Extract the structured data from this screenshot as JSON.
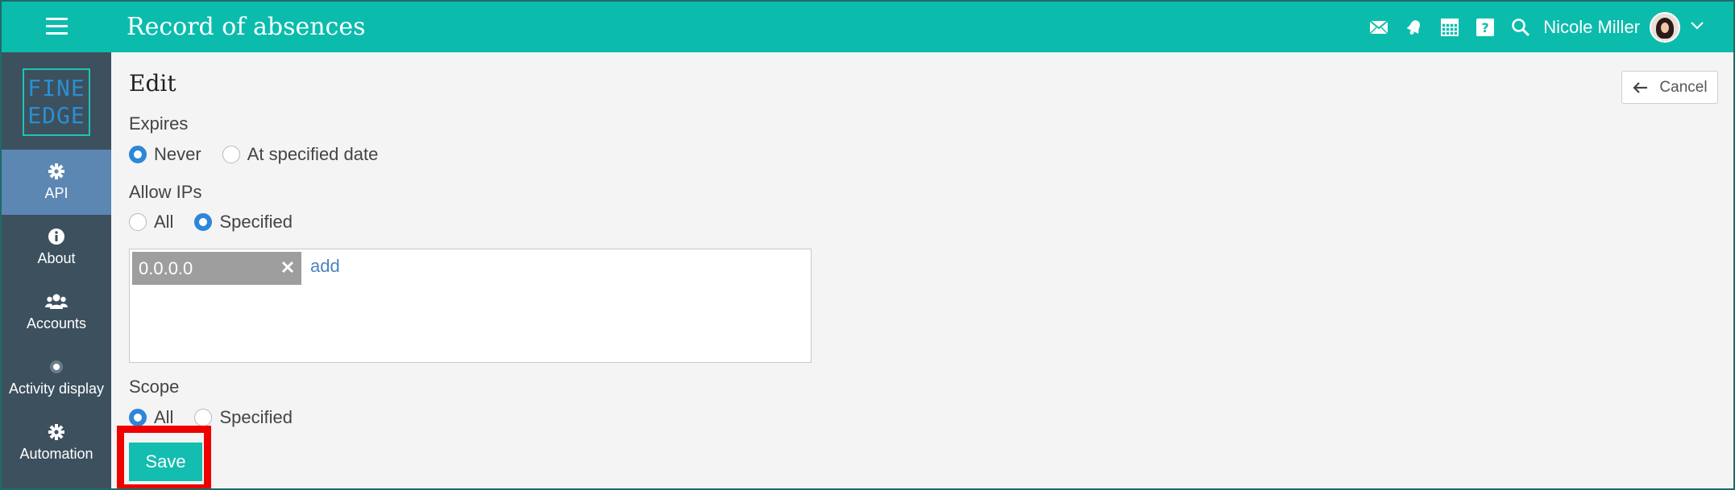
{
  "app": {
    "title": "Record of absences"
  },
  "user": {
    "name": "Nicole Miller"
  },
  "logo": {
    "line1": "FINE",
    "line2": "EDGE"
  },
  "sidebar": {
    "items": [
      {
        "label": "API",
        "icon": "gear-icon",
        "active": true
      },
      {
        "label": "About",
        "icon": "info-icon",
        "active": false
      },
      {
        "label": "Accounts",
        "icon": "users-icon",
        "active": false
      },
      {
        "label": "Activity display",
        "icon": "dot-circle-icon",
        "active": false
      },
      {
        "label": "Automation",
        "icon": "gear-icon",
        "active": false
      }
    ]
  },
  "page": {
    "heading": "Edit",
    "cancel_label": "Cancel"
  },
  "expires": {
    "label": "Expires",
    "options": [
      "Never",
      "At specified date"
    ],
    "selected": "Never"
  },
  "allow_ips": {
    "label": "Allow IPs",
    "options": [
      "All",
      "Specified"
    ],
    "selected": "Specified",
    "ips": [
      "0.0.0.0"
    ],
    "add_label": "add"
  },
  "scope": {
    "label": "Scope",
    "options": [
      "All",
      "Specified"
    ],
    "selected": "All"
  },
  "save_label": "Save",
  "colors": {
    "topbar": "#0bbcad",
    "sidebar": "#3c505e",
    "sidebar_active": "#5b87b2",
    "radio_checked": "#2d86d9",
    "highlight": "#ef0000"
  }
}
